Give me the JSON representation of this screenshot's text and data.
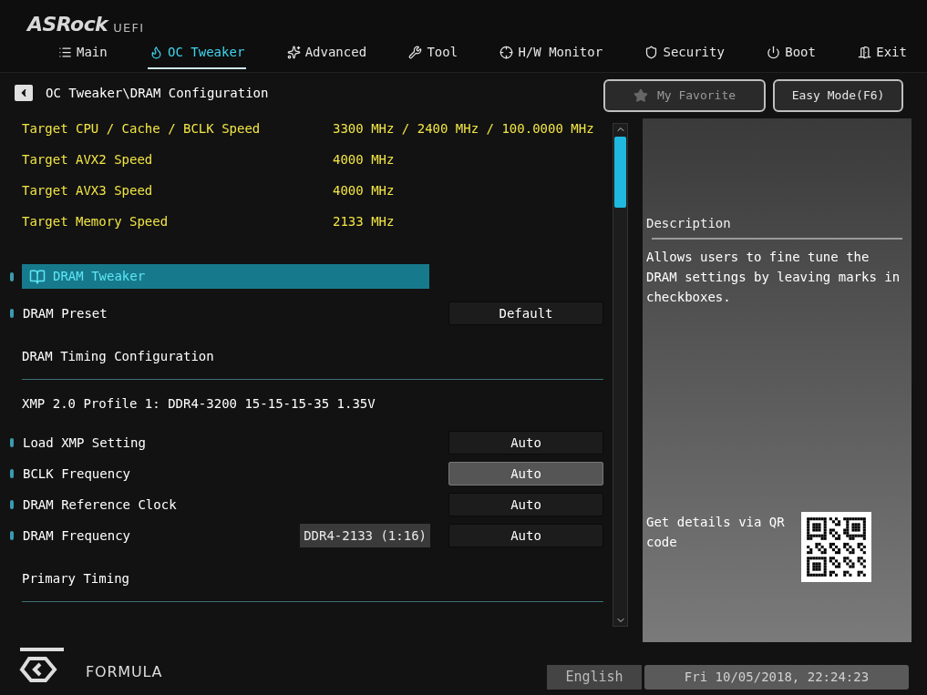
{
  "logo": {
    "brand": "ASRock",
    "suffix": "UEFI"
  },
  "tabs": [
    {
      "label": "Main",
      "selected": false
    },
    {
      "label": "OC Tweaker",
      "selected": true
    },
    {
      "label": "Advanced",
      "selected": false
    },
    {
      "label": "Tool",
      "selected": false
    },
    {
      "label": "H/W Monitor",
      "selected": false
    },
    {
      "label": "Security",
      "selected": false
    },
    {
      "label": "Boot",
      "selected": false
    },
    {
      "label": "Exit",
      "selected": false
    }
  ],
  "breadcrumb": "OC Tweaker\\DRAM Configuration",
  "top_buttons": [
    {
      "label": "My Favorite",
      "kind": "favorite"
    },
    {
      "label": "Easy Mode(F6)",
      "kind": "plain"
    }
  ],
  "targets": [
    {
      "label": "Target CPU / Cache / BCLK Speed",
      "value": "3300 MHz / 2400 MHz / 100.0000 MHz"
    },
    {
      "label": "Target AVX2 Speed",
      "value": "4000 MHz"
    },
    {
      "label": "Target AVX3 Speed",
      "value": "4000 MHz"
    },
    {
      "label": "Target Memory Speed",
      "value": "2133 MHz"
    }
  ],
  "items": [
    {
      "kind": "submenu",
      "label": "DRAM Tweaker",
      "selected": true
    },
    {
      "kind": "option",
      "label": "DRAM Preset",
      "value": "Default",
      "selected": false
    },
    {
      "kind": "section",
      "label": "DRAM Timing Configuration"
    },
    {
      "kind": "text",
      "label": "XMP 2.0 Profile 1: DDR4-3200 15-15-15-35 1.35V"
    },
    {
      "kind": "option",
      "label": "Load XMP Setting",
      "value": "Auto",
      "selected": false
    },
    {
      "kind": "option",
      "label": "BCLK Frequency",
      "value": "Auto",
      "selected": true
    },
    {
      "kind": "option",
      "label": "DRAM Reference Clock",
      "value": "Auto",
      "selected": false
    },
    {
      "kind": "option",
      "label": "DRAM Frequency",
      "value": "Auto",
      "current": "DDR4-2133 (1:16)",
      "selected": false
    },
    {
      "kind": "section",
      "label": "Primary Timing"
    }
  ],
  "description": {
    "title": "Description",
    "text": "Allows users to fine tune the DRAM settings by leaving marks in checkboxes."
  },
  "qr": {
    "text": "Get details via QR code"
  },
  "footer": {
    "logo_text": "FORMULA",
    "language": "English",
    "datetime": "Fri 10/05/2018, 22:24:23"
  }
}
